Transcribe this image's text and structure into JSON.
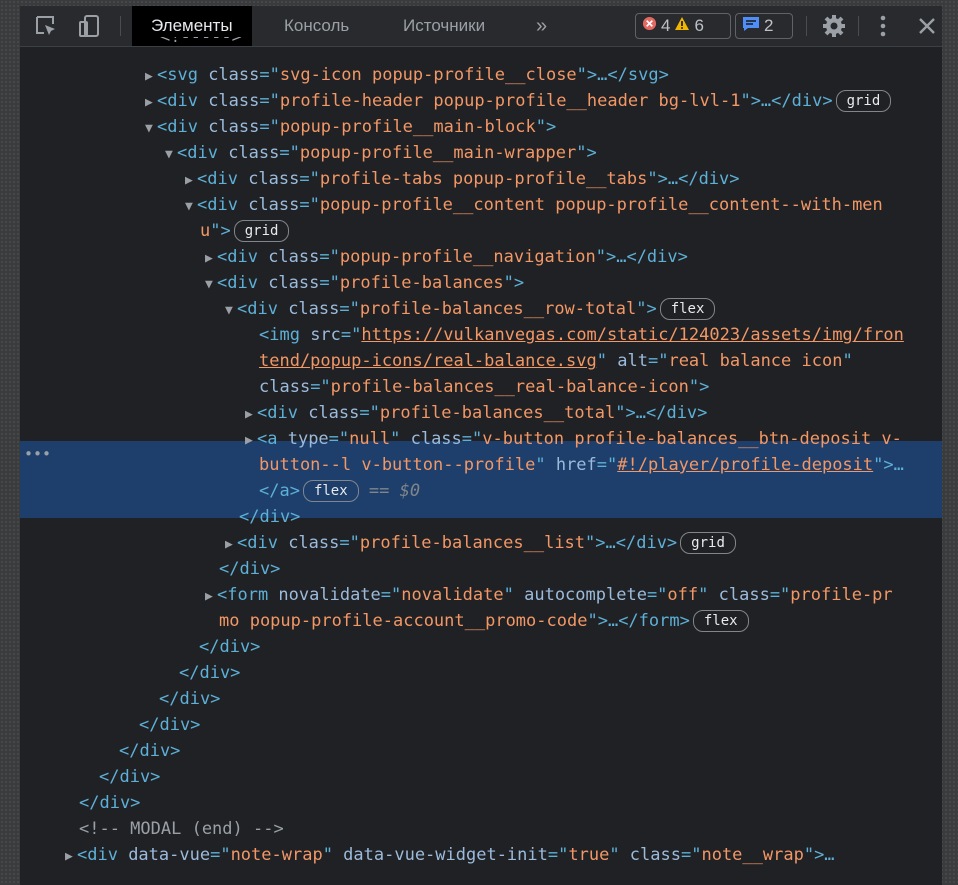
{
  "toolbar": {
    "tabs": [
      "Элементы",
      "Консоль",
      "Источники"
    ],
    "more": "»",
    "errors": "4",
    "warnings": "6",
    "messages": "2"
  },
  "dom": {
    "l0": "<!----->",
    "l1": {
      "open": "<svg",
      "cls": "svg-icon popup-profile__close",
      "close": ">…</svg>"
    },
    "l2": {
      "cls": "profile-header popup-profile__header bg-lvl-1",
      "close": ">…</div>",
      "badge": "grid"
    },
    "l3": {
      "cls": "popup-profile__main-block"
    },
    "l4": {
      "cls": "popup-profile__main-wrapper"
    },
    "l5": {
      "cls": "profile-tabs popup-profile__tabs",
      "close": ">…</div>"
    },
    "l6": {
      "cls_a": "popup-profile__content popup-profile__content--with-men",
      "cls_b": "u",
      "badge": "grid"
    },
    "l7": {
      "cls": "popup-profile__navigation",
      "close": ">…</div>"
    },
    "l8": {
      "cls": "profile-balances"
    },
    "l9": {
      "cls": "profile-balances__row-total",
      "badge": "flex"
    },
    "img": {
      "src_a": "https://vulkanvegas.com/static/124023/assets/img/fron",
      "src_b": "tend/popup-icons/real-balance.svg",
      "alt": "real balance icon",
      "cls": "profile-balances__real-balance-icon"
    },
    "l10": {
      "cls": "profile-balances__total",
      "close": ">…</div>"
    },
    "sel": {
      "type": "null",
      "cls_a": "v-button profile-balances__btn-deposit v-",
      "cls_b": "button--l v-button--profile",
      "href": "#!/player/profile-deposit",
      "badge": "flex",
      "eq": "== $0"
    },
    "l11": {
      "cls": "profile-balances__list",
      "close": ">…</div>",
      "badge": "grid"
    },
    "form": {
      "novalidate": "novalidate",
      "autocomplete": "off",
      "cls_a": "profile-pr",
      "cls_b": "mo popup-profile-account__promo-code",
      "close": ">…</form>",
      "badge": "flex"
    },
    "comment": "<!-- MODAL (end) -->",
    "last": {
      "vue": "note-wrap",
      "init": "true",
      "cls": "note__wrap"
    }
  },
  "colors": {
    "tag": "#5db0d7",
    "attr": "#9bbbdc",
    "value": "#f29766",
    "selection": "#1e3f6b"
  }
}
